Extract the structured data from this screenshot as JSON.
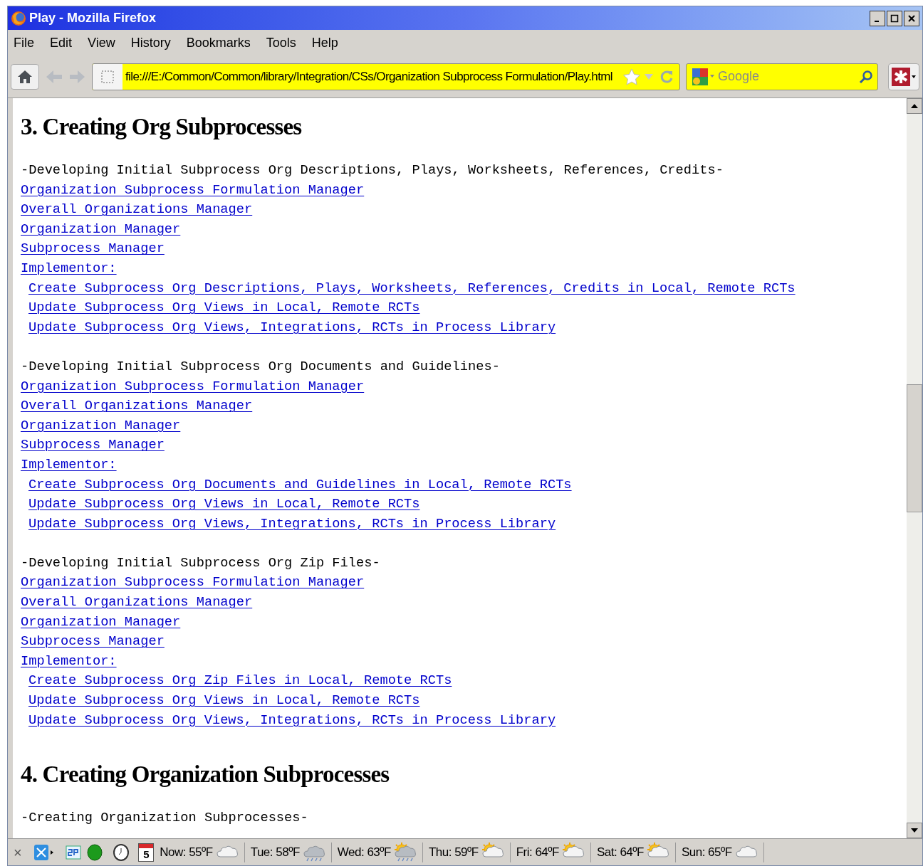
{
  "window": {
    "title": "Play - Mozilla Firefox"
  },
  "menu": [
    "File",
    "Edit",
    "View",
    "History",
    "Bookmarks",
    "Tools",
    "Help"
  ],
  "address": {
    "value": "file:///E:/Common/Common/library/Integration/CSs/Organization Subprocess Formulation/Play.html"
  },
  "search": {
    "placeholder": "Google"
  },
  "sections": [
    {
      "heading": "3. Creating Org Subprocesses",
      "groups": [
        {
          "title": "-Developing Initial Subprocess Org Descriptions, Plays, Worksheets, References, Credits-",
          "links": [
            {
              "text": "Organization Subprocess Formulation Manager"
            },
            {
              "text": "Overall Organizations Manager"
            },
            {
              "text": "Organization Manager"
            },
            {
              "text": "Subprocess Manager"
            },
            {
              "text": "Implementor:",
              "children": [
                {
                  "text": "Create Subprocess Org Descriptions, Plays, Worksheets, References, Credits in Local, Remote RCTs"
                },
                {
                  "text": "Update Subprocess Org Views in Local, Remote RCTs"
                },
                {
                  "text": "Update Subprocess Org Views, Integrations, RCTs in Process Library"
                }
              ]
            }
          ]
        },
        {
          "title": "-Developing Initial Subprocess Org Documents and Guidelines-",
          "links": [
            {
              "text": "Organization Subprocess Formulation Manager"
            },
            {
              "text": "Overall Organizations Manager"
            },
            {
              "text": "Organization Manager"
            },
            {
              "text": "Subprocess Manager"
            },
            {
              "text": "Implementor:",
              "children": [
                {
                  "text": "Create Subprocess Org Documents and Guidelines in Local, Remote RCTs"
                },
                {
                  "text": "Update Subprocess Org Views in Local, Remote RCTs"
                },
                {
                  "text": "Update Subprocess Org Views, Integrations, RCTs in Process Library"
                }
              ]
            }
          ]
        },
        {
          "title": "-Developing Initial Subprocess Org Zip Files-",
          "links": [
            {
              "text": "Organization Subprocess Formulation Manager"
            },
            {
              "text": "Overall Organizations Manager"
            },
            {
              "text": "Organization Manager"
            },
            {
              "text": "Subprocess Manager"
            },
            {
              "text": "Implementor:",
              "children": [
                {
                  "text": "Create Subprocess Org Zip Files in Local, Remote RCTs"
                },
                {
                  "text": "Update Subprocess Org Views in Local, Remote RCTs"
                },
                {
                  "text": "Update Subprocess Org Views, Integrations, RCTs in Process Library"
                }
              ]
            }
          ]
        }
      ]
    },
    {
      "heading": "4. Creating Organization Subprocesses",
      "groups": [
        {
          "title": "-Creating Organization Subprocesses-"
        }
      ]
    }
  ],
  "status_bar": {
    "close": "×",
    "calendar_day": "5",
    "weather": [
      {
        "label": "Now: 55ºF",
        "kind": "cloudy"
      },
      {
        "label": "Tue: 58ºF",
        "kind": "rain"
      },
      {
        "label": "Wed: 63ºF",
        "kind": "sun-rain"
      },
      {
        "label": "Thu: 59ºF",
        "kind": "partly-sunny"
      },
      {
        "label": "Fri: 64ºF",
        "kind": "partly-sunny"
      },
      {
        "label": "Sat: 64ºF",
        "kind": "partly-sunny"
      },
      {
        "label": "Sun: 65ºF",
        "kind": "cloudy"
      }
    ]
  }
}
